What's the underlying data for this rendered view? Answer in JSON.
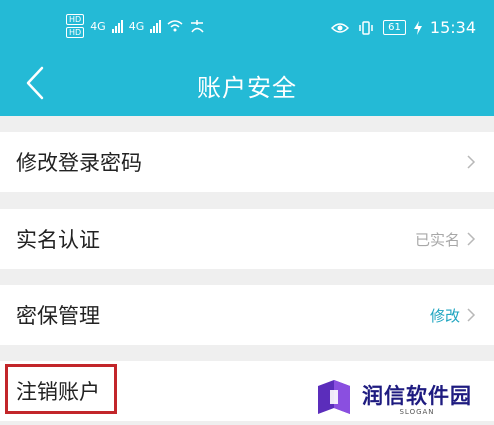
{
  "status_bar": {
    "hd_1": "HD",
    "hd_2": "HD",
    "net_1": "4G",
    "net_2": "4G",
    "battery": "61",
    "time": "15:34"
  },
  "header": {
    "title": "账户安全"
  },
  "rows": [
    {
      "label": "修改登录密码",
      "value": ""
    },
    {
      "label": "实名认证",
      "value": "已实名"
    },
    {
      "label": "密保管理",
      "value": "修改"
    },
    {
      "label": "注销账户",
      "value": ""
    }
  ],
  "watermark": {
    "name": "润信软件园",
    "slogan": "SLOGAN"
  },
  "colors": {
    "header_bg": "#24bad6",
    "verified_text": "#a8a8a8",
    "modify_text": "#1fa5c0",
    "highlight_border": "#c2262a",
    "watermark_text": "#1e1b80"
  }
}
